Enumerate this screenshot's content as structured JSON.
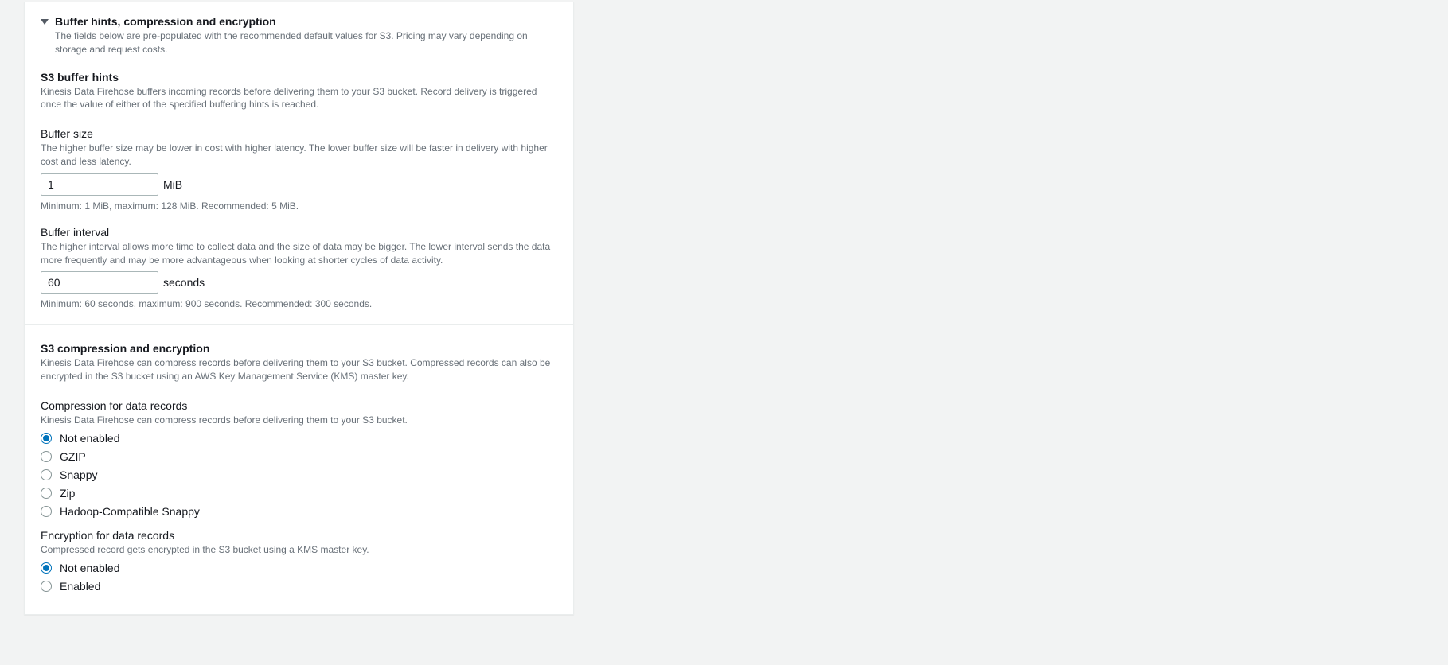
{
  "header": {
    "title": "Buffer hints, compression and encryption",
    "desc": "The fields below are pre-populated with the recommended default values for S3. Pricing may vary depending on storage and request costs."
  },
  "buffer_hints": {
    "title": "S3 buffer hints",
    "desc": "Kinesis Data Firehose buffers incoming records before delivering them to your S3 bucket. Record delivery is triggered once the value of either of the specified buffering hints is reached.",
    "size": {
      "label": "Buffer size",
      "hint": "The higher buffer size may be lower in cost with higher latency. The lower buffer size will be faster in delivery with higher cost and less latency.",
      "value": "1",
      "unit": "MiB",
      "constraint": "Minimum: 1 MiB, maximum: 128 MiB. Recommended: 5 MiB."
    },
    "interval": {
      "label": "Buffer interval",
      "hint": "The higher interval allows more time to collect data and the size of data may be bigger. The lower interval sends the data more frequently and may be more advantageous when looking at shorter cycles of data activity.",
      "value": "60",
      "unit": "seconds",
      "constraint": "Minimum: 60 seconds, maximum: 900 seconds. Recommended: 300 seconds."
    }
  },
  "comp_enc": {
    "title": "S3 compression and encryption",
    "desc": "Kinesis Data Firehose can compress records before delivering them to your S3 bucket. Compressed records can also be encrypted in the S3 bucket using an AWS Key Management Service (KMS) master key.",
    "compression": {
      "label": "Compression for data records",
      "hint": "Kinesis Data Firehose can compress records before delivering them to your S3 bucket.",
      "options": [
        "Not enabled",
        "GZIP",
        "Snappy",
        "Zip",
        "Hadoop-Compatible Snappy"
      ],
      "selected": "Not enabled"
    },
    "encryption": {
      "label": "Encryption for data records",
      "hint": "Compressed record gets encrypted in the S3 bucket using a KMS master key.",
      "options": [
        "Not enabled",
        "Enabled"
      ],
      "selected": "Not enabled"
    }
  }
}
